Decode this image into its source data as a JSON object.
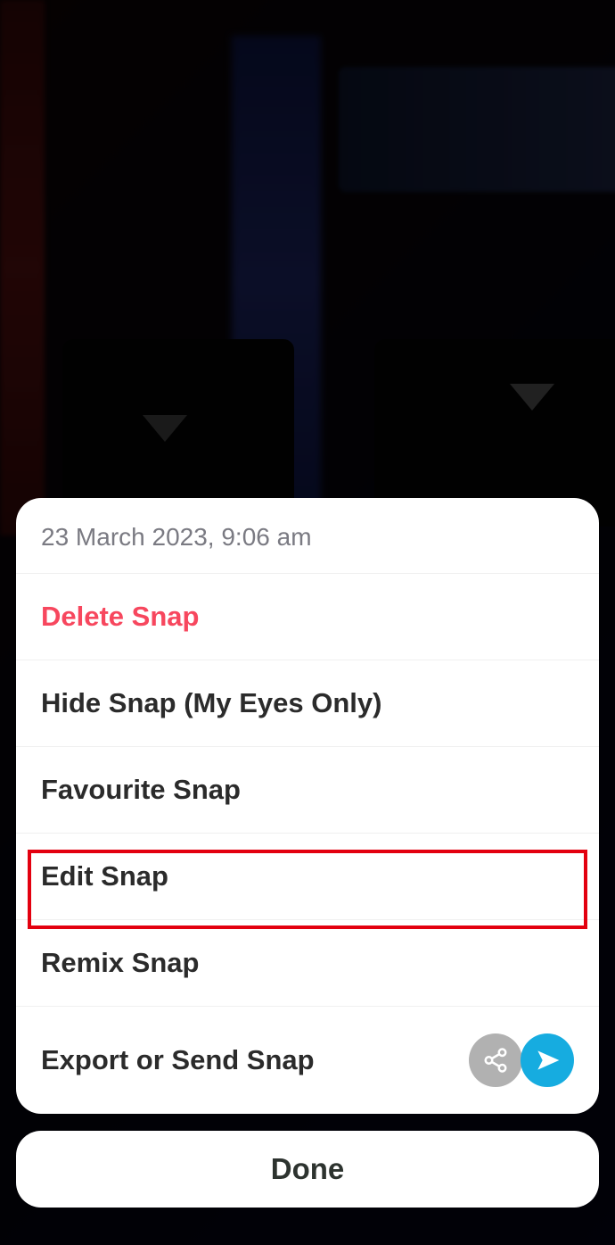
{
  "sheet": {
    "timestamp": "23 March 2023, 9:06 am",
    "items": {
      "delete": "Delete Snap",
      "hide": "Hide Snap (My Eyes Only)",
      "favourite": "Favourite Snap",
      "edit": "Edit Snap",
      "remix": "Remix Snap",
      "export": "Export or Send Snap"
    }
  },
  "done_label": "Done"
}
